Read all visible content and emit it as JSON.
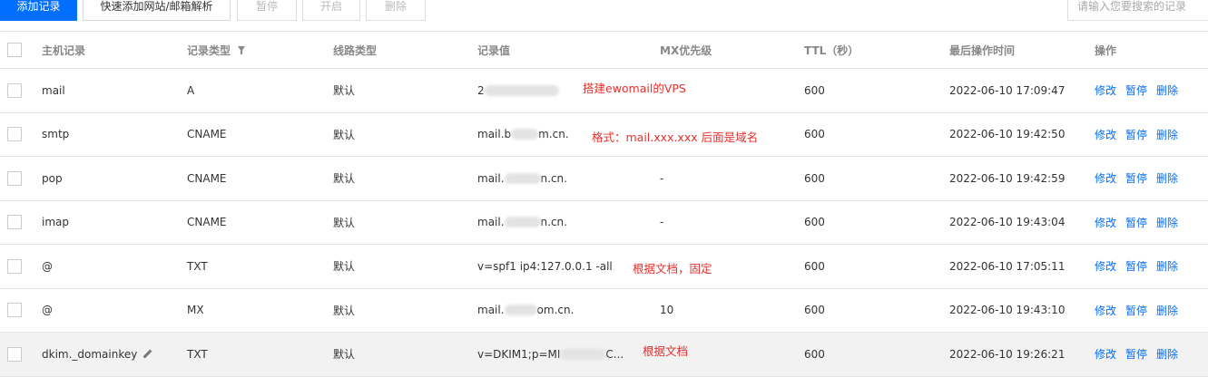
{
  "toolbar": {
    "add_record": "添加记录",
    "quick_add": "快速添加网站/邮箱解析",
    "pause": "暂停",
    "enable": "开启",
    "delete": "删除",
    "search_placeholder": "请输入您要搜索的记录"
  },
  "table": {
    "headers": {
      "host": "主机记录",
      "type": "记录类型",
      "line": "线路类型",
      "value": "记录值",
      "mx": "MX优先级",
      "ttl": "TTL（秒）",
      "time": "最后操作时间",
      "ops": "操作"
    },
    "actions": {
      "modify": "修改",
      "pause": "暂停",
      "delete": "删除"
    },
    "rows": [
      {
        "host": "mail",
        "type": "A",
        "line": "默认",
        "value_pre": "2",
        "value_post": "",
        "mx": "",
        "ttl": "600",
        "time": "2022-06-10 17:09:47",
        "note": "搭建ewomail的VPS"
      },
      {
        "host": "smtp",
        "type": "CNAME",
        "line": "默认",
        "value_pre": "mail.b",
        "value_post": "m.cn.",
        "mx": "",
        "ttl": "600",
        "time": "2022-06-10 19:42:50",
        "note": "格式：mail.xxx.xxx 后面是域名"
      },
      {
        "host": "pop",
        "type": "CNAME",
        "line": "默认",
        "value_pre": "mail.",
        "value_post": "n.cn.",
        "mx": "-",
        "ttl": "600",
        "time": "2022-06-10 19:42:59",
        "note": ""
      },
      {
        "host": "imap",
        "type": "CNAME",
        "line": "默认",
        "value_pre": "mail.",
        "value_post": "n.cn.",
        "mx": "-",
        "ttl": "600",
        "time": "2022-06-10 19:43:04",
        "note": ""
      },
      {
        "host": "@",
        "type": "TXT",
        "line": "默认",
        "value_pre": "v=spf1 ip4:127.0.0.1 -all",
        "value_post": "",
        "mx": "",
        "ttl": "600",
        "time": "2022-06-10 17:05:11",
        "note": "根据文档，固定"
      },
      {
        "host": "@",
        "type": "MX",
        "line": "默认",
        "value_pre": "mail.",
        "value_post": "om.cn.",
        "mx": "10",
        "ttl": "600",
        "time": "2022-06-10 19:43:10",
        "note": ""
      },
      {
        "host": "dkim._domainkey",
        "type": "TXT",
        "line": "默认",
        "value_pre": "v=DKIM1;p=MI",
        "value_post": "C...",
        "mx": "",
        "ttl": "600",
        "time": "2022-06-10 19:26:21",
        "note": "根据文档"
      }
    ]
  },
  "icons": {
    "filter": "filter-icon",
    "edit": "pencil-icon",
    "checkbox": "checkbox"
  },
  "colors": {
    "primary": "#006eff",
    "note_red": "#e5302d",
    "header_text": "#888888"
  }
}
